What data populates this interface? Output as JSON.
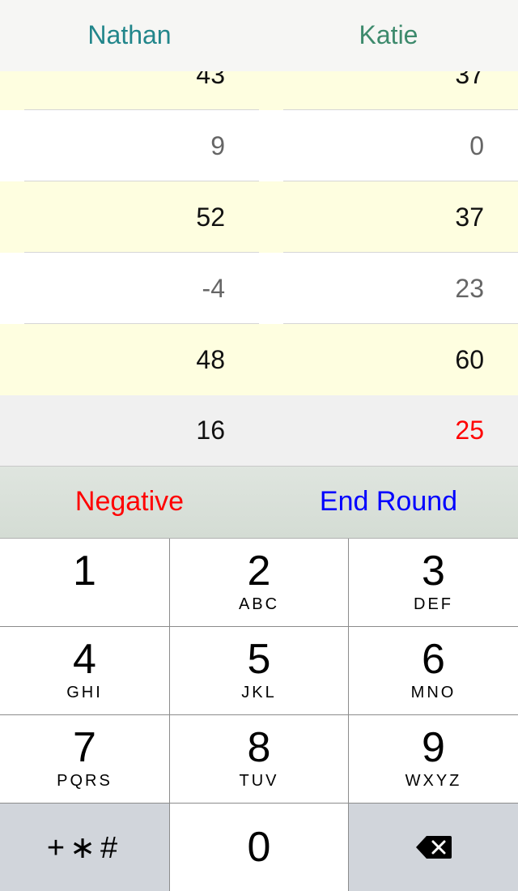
{
  "header": {
    "players": [
      {
        "name": "Nathan",
        "color": "#22868b"
      },
      {
        "name": "Katie",
        "color": "#3d8a6c"
      }
    ]
  },
  "rounds": [
    {
      "scores": [
        "43",
        "37"
      ],
      "style": "yellow"
    },
    {
      "scores": [
        "9",
        "0"
      ],
      "style": "white"
    },
    {
      "scores": [
        "52",
        "37"
      ],
      "style": "yellow"
    },
    {
      "scores": [
        "-4",
        "23"
      ],
      "style": "white"
    },
    {
      "scores": [
        "48",
        "60"
      ],
      "style": "yellow"
    }
  ],
  "totals": [
    {
      "value": "16",
      "color": "#111111"
    },
    {
      "value": "25",
      "color": "#ff0000"
    }
  ],
  "actions": {
    "negative_label": "Negative",
    "negative_color": "#ff0000",
    "end_round_label": "End Round",
    "end_round_color": "#0000ff"
  },
  "keypad": {
    "keys": [
      {
        "digit": "1",
        "letters": ""
      },
      {
        "digit": "2",
        "letters": "ABC"
      },
      {
        "digit": "3",
        "letters": "DEF"
      },
      {
        "digit": "4",
        "letters": "GHI"
      },
      {
        "digit": "5",
        "letters": "JKL"
      },
      {
        "digit": "6",
        "letters": "MNO"
      },
      {
        "digit": "7",
        "letters": "PQRS"
      },
      {
        "digit": "8",
        "letters": "TUV"
      },
      {
        "digit": "9",
        "letters": "WXYZ"
      }
    ],
    "symbols": "+∗#",
    "zero": "0",
    "backspace_icon": "backspace-icon"
  }
}
